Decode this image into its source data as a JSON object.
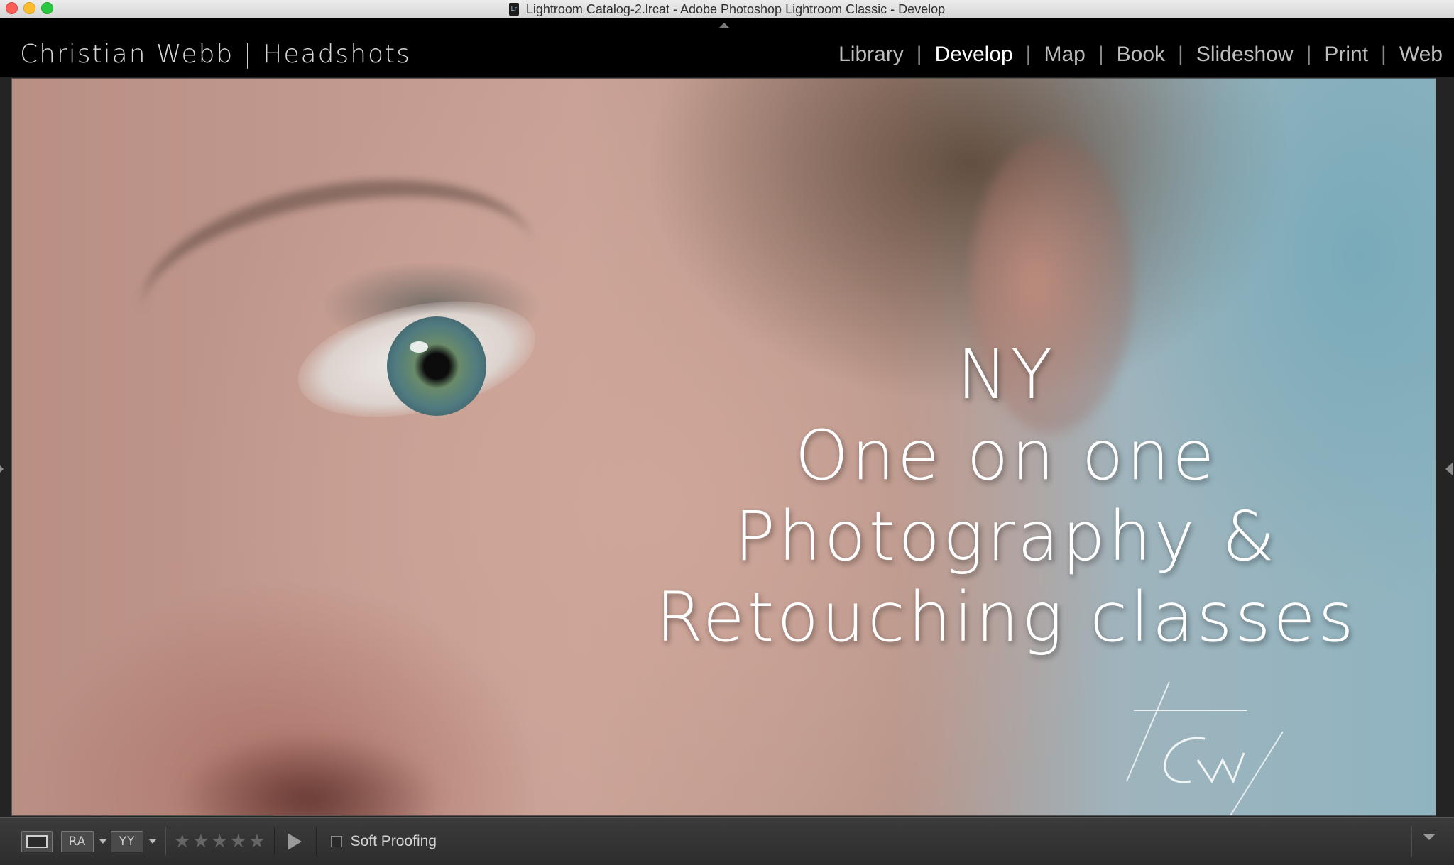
{
  "window": {
    "title": "Lightroom Catalog-2.lrcat - Adobe Photoshop Lightroom Classic - Develop",
    "doc_icon_text": "Lr"
  },
  "identity_plate": "Christian Webb | Headshots",
  "modules": [
    {
      "label": "Library",
      "active": false
    },
    {
      "label": "Develop",
      "active": true
    },
    {
      "label": "Map",
      "active": false
    },
    {
      "label": "Book",
      "active": false
    },
    {
      "label": "Slideshow",
      "active": false
    },
    {
      "label": "Print",
      "active": false
    },
    {
      "label": "Web",
      "active": false
    }
  ],
  "module_separator": "|",
  "photo": {
    "overlay_lines": [
      "NY",
      "One on one",
      "Photography &",
      "Retouching classes"
    ],
    "signature_text": "CW"
  },
  "toolbar": {
    "view_ra_label": "RA",
    "view_yy_label": "YY",
    "rating_stars": 0,
    "rating_max": 5,
    "star_glyph": "★",
    "soft_proofing_label": "Soft Proofing",
    "soft_proofing_checked": false
  },
  "colors": {
    "background": "#000000",
    "active_module": "#ffffff",
    "inactive_module": "#bdbdbd",
    "toolbar_bg": "#333333"
  }
}
